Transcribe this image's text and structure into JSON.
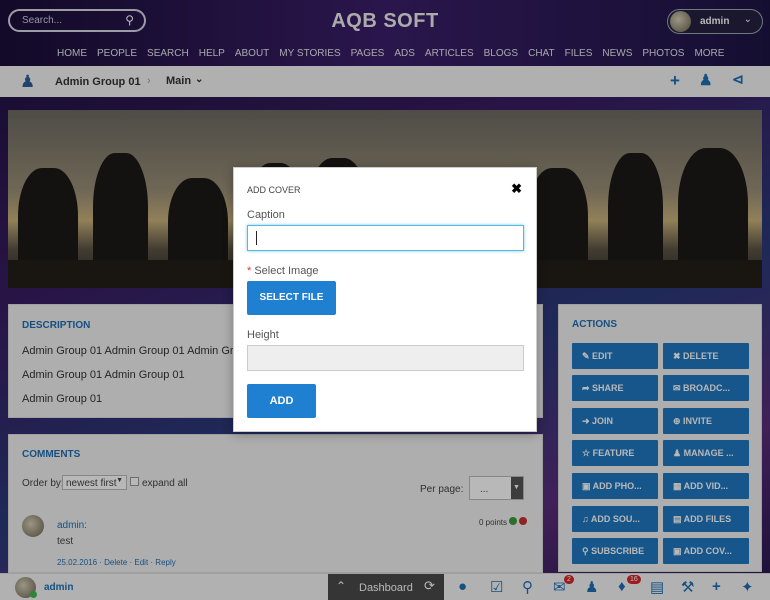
{
  "header": {
    "search_placeholder": "Search...",
    "brand": "AQB SOFT",
    "user": "admin",
    "nav": [
      "HOME",
      "PEOPLE",
      "SEARCH",
      "HELP",
      "ABOUT",
      "MY STORIES",
      "PAGES",
      "ADS",
      "ARTICLES",
      "BLOGS",
      "CHAT",
      "FILES",
      "NEWS",
      "PHOTOS",
      "MORE"
    ]
  },
  "breadcrumb": {
    "group": "Admin Group 01",
    "section": "Main"
  },
  "description": {
    "heading": "DESCRIPTION",
    "lines": [
      "Admin Group 01 Admin Group 01 Admin Group",
      "Admin Group 01 Admin Group 01",
      "Admin Group 01"
    ]
  },
  "comments": {
    "heading": "COMMENTS",
    "order_label": "Order by:",
    "order_value": "newest first",
    "expand_label": "expand all",
    "per_page_label": "Per page:",
    "per_page_value": "...",
    "author": "admin:",
    "text": "test",
    "points": "0 points",
    "meta": [
      "25.02.2016",
      "Delete",
      "Edit",
      "Reply"
    ]
  },
  "actions": {
    "heading": "ACTIONS",
    "buttons": [
      "EDIT",
      "DELETE",
      "SHARE",
      "BROADC...",
      "JOIN",
      "INVITE",
      "FEATURE",
      "MANAGE ...",
      "ADD PHO...",
      "ADD VID...",
      "ADD SOU...",
      "ADD FILES",
      "SUBSCRIBE",
      "ADD COV..."
    ]
  },
  "modal": {
    "title": "ADD COVER",
    "caption_label": "Caption",
    "caption_value": "",
    "image_required": "*",
    "image_label": "Select Image",
    "select_file": "SELECT FILE",
    "height_label": "Height",
    "height_value": "",
    "add": "ADD"
  },
  "bottombar": {
    "user": "admin",
    "dashboard": "Dashboard",
    "badges": {
      "mail": "2",
      "notifications": "16"
    }
  },
  "colors": {
    "accent": "#1f78c1",
    "link": "#1f6fb5",
    "badge": "#d9292b"
  }
}
